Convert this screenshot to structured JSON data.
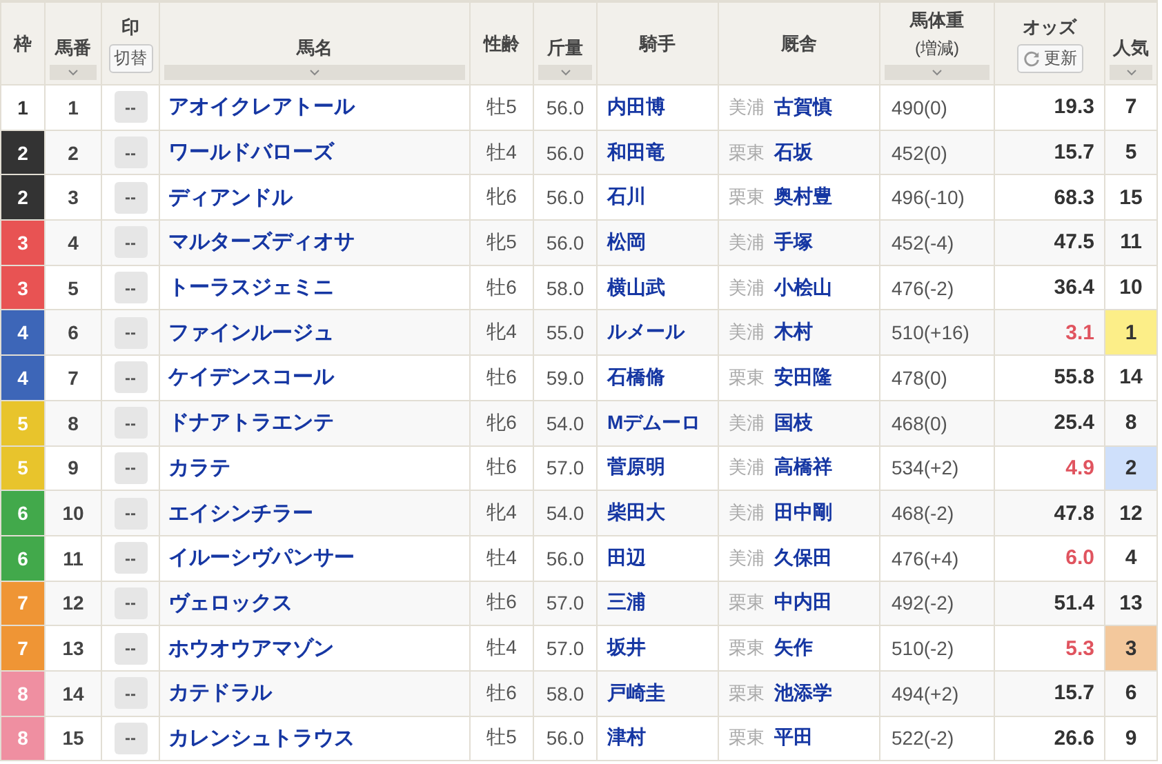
{
  "columns": [
    {
      "kind": "plain",
      "label": "枠"
    },
    {
      "kind": "sort",
      "label": "馬番"
    },
    {
      "kind": "toggle",
      "label": "印",
      "button": "切替"
    },
    {
      "kind": "sort",
      "label": "馬名"
    },
    {
      "kind": "plain",
      "label": "性齢"
    },
    {
      "kind": "sort",
      "label": "斤量"
    },
    {
      "kind": "plain",
      "label": "騎手"
    },
    {
      "kind": "plain",
      "label": "厩舎"
    },
    {
      "kind": "sort",
      "label": "馬体重",
      "sublabel": "(増減)"
    },
    {
      "kind": "refresh",
      "label": "オッズ",
      "button": "更新"
    },
    {
      "kind": "sort",
      "label": "人気"
    }
  ],
  "rows": [
    {
      "frame": {
        "label": "1",
        "color": "#ffffff"
      },
      "number": "1",
      "mark": "--",
      "name": "アオイクレアトール",
      "sex_age": "牡5",
      "weight_carried": "56.0",
      "jockey": "内田博",
      "region": "美浦",
      "trainer": "古賀慎",
      "body_weight": "490(0)",
      "odds": "19.3",
      "odds_hot": false,
      "popularity": {
        "label": "7"
      }
    },
    {
      "frame": {
        "label": "2",
        "color": "#333333"
      },
      "number": "2",
      "mark": "--",
      "name": "ワールドバローズ",
      "sex_age": "牡4",
      "weight_carried": "56.0",
      "jockey": "和田竜",
      "region": "栗東",
      "trainer": "石坂",
      "body_weight": "452(0)",
      "odds": "15.7",
      "odds_hot": false,
      "popularity": {
        "label": "5"
      }
    },
    {
      "frame": {
        "label": "2",
        "color": "#333333"
      },
      "number": "3",
      "mark": "--",
      "name": "ディアンドル",
      "sex_age": "牝6",
      "weight_carried": "56.0",
      "jockey": "石川",
      "region": "栗東",
      "trainer": "奥村豊",
      "body_weight": "496(-10)",
      "odds": "68.3",
      "odds_hot": false,
      "popularity": {
        "label": "15"
      }
    },
    {
      "frame": {
        "label": "3",
        "color": "#e85353"
      },
      "number": "4",
      "mark": "--",
      "name": "マルターズディオサ",
      "sex_age": "牝5",
      "weight_carried": "56.0",
      "jockey": "松岡",
      "region": "美浦",
      "trainer": "手塚",
      "body_weight": "452(-4)",
      "odds": "47.5",
      "odds_hot": false,
      "popularity": {
        "label": "11"
      }
    },
    {
      "frame": {
        "label": "3",
        "color": "#e85353"
      },
      "number": "5",
      "mark": "--",
      "name": "トーラスジェミニ",
      "sex_age": "牡6",
      "weight_carried": "58.0",
      "jockey": "横山武",
      "region": "美浦",
      "trainer": "小桧山",
      "body_weight": "476(-2)",
      "odds": "36.4",
      "odds_hot": false,
      "popularity": {
        "label": "10"
      }
    },
    {
      "frame": {
        "label": "4",
        "color": "#3d66b8"
      },
      "number": "6",
      "mark": "--",
      "name": "ファインルージュ",
      "sex_age": "牝4",
      "weight_carried": "55.0",
      "jockey": "ルメール",
      "region": "美浦",
      "trainer": "木村",
      "body_weight": "510(+16)",
      "odds": "3.1",
      "odds_hot": true,
      "popularity": {
        "label": "1",
        "color": "#fcee88"
      }
    },
    {
      "frame": {
        "label": "4",
        "color": "#3d66b8"
      },
      "number": "7",
      "mark": "--",
      "name": "ケイデンスコール",
      "sex_age": "牡6",
      "weight_carried": "59.0",
      "jockey": "石橋脩",
      "region": "栗東",
      "trainer": "安田隆",
      "body_weight": "478(0)",
      "odds": "55.8",
      "odds_hot": false,
      "popularity": {
        "label": "14"
      }
    },
    {
      "frame": {
        "label": "5",
        "color": "#e8c42c"
      },
      "number": "8",
      "mark": "--",
      "name": "ドナアトラエンテ",
      "sex_age": "牝6",
      "weight_carried": "54.0",
      "jockey": "Mデムーロ",
      "region": "美浦",
      "trainer": "国枝",
      "body_weight": "468(0)",
      "odds": "25.4",
      "odds_hot": false,
      "popularity": {
        "label": "8"
      }
    },
    {
      "frame": {
        "label": "5",
        "color": "#e8c42c"
      },
      "number": "9",
      "mark": "--",
      "name": "カラテ",
      "sex_age": "牡6",
      "weight_carried": "57.0",
      "jockey": "菅原明",
      "region": "美浦",
      "trainer": "高橋祥",
      "body_weight": "534(+2)",
      "odds": "4.9",
      "odds_hot": true,
      "popularity": {
        "label": "2",
        "color": "#cfe0fb"
      }
    },
    {
      "frame": {
        "label": "6",
        "color": "#42a94b"
      },
      "number": "10",
      "mark": "--",
      "name": "エイシンチラー",
      "sex_age": "牝4",
      "weight_carried": "54.0",
      "jockey": "柴田大",
      "region": "美浦",
      "trainer": "田中剛",
      "body_weight": "468(-2)",
      "odds": "47.8",
      "odds_hot": false,
      "popularity": {
        "label": "12"
      }
    },
    {
      "frame": {
        "label": "6",
        "color": "#42a94b"
      },
      "number": "11",
      "mark": "--",
      "name": "イルーシヴパンサー",
      "sex_age": "牡4",
      "weight_carried": "56.0",
      "jockey": "田辺",
      "region": "美浦",
      "trainer": "久保田",
      "body_weight": "476(+4)",
      "odds": "6.0",
      "odds_hot": true,
      "popularity": {
        "label": "4"
      }
    },
    {
      "frame": {
        "label": "7",
        "color": "#ef9535"
      },
      "number": "12",
      "mark": "--",
      "name": "ヴェロックス",
      "sex_age": "牡6",
      "weight_carried": "57.0",
      "jockey": "三浦",
      "region": "栗東",
      "trainer": "中内田",
      "body_weight": "492(-2)",
      "odds": "51.4",
      "odds_hot": false,
      "popularity": {
        "label": "13"
      }
    },
    {
      "frame": {
        "label": "7",
        "color": "#ef9535"
      },
      "number": "13",
      "mark": "--",
      "name": "ホウオウアマゾン",
      "sex_age": "牡4",
      "weight_carried": "57.0",
      "jockey": "坂井",
      "region": "栗東",
      "trainer": "矢作",
      "body_weight": "510(-2)",
      "odds": "5.3",
      "odds_hot": true,
      "popularity": {
        "label": "3",
        "color": "#f3c89c"
      }
    },
    {
      "frame": {
        "label": "8",
        "color": "#ef8fa1"
      },
      "number": "14",
      "mark": "--",
      "name": "カテドラル",
      "sex_age": "牡6",
      "weight_carried": "58.0",
      "jockey": "戸崎圭",
      "region": "栗東",
      "trainer": "池添学",
      "body_weight": "494(+2)",
      "odds": "15.7",
      "odds_hot": false,
      "popularity": {
        "label": "6"
      }
    },
    {
      "frame": {
        "label": "8",
        "color": "#ef8fa1"
      },
      "number": "15",
      "mark": "--",
      "name": "カレンシュトラウス",
      "sex_age": "牡5",
      "weight_carried": "56.0",
      "jockey": "津村",
      "region": "栗東",
      "trainer": "平田",
      "body_weight": "522(-2)",
      "odds": "26.6",
      "odds_hot": false,
      "popularity": {
        "label": "9"
      }
    }
  ]
}
